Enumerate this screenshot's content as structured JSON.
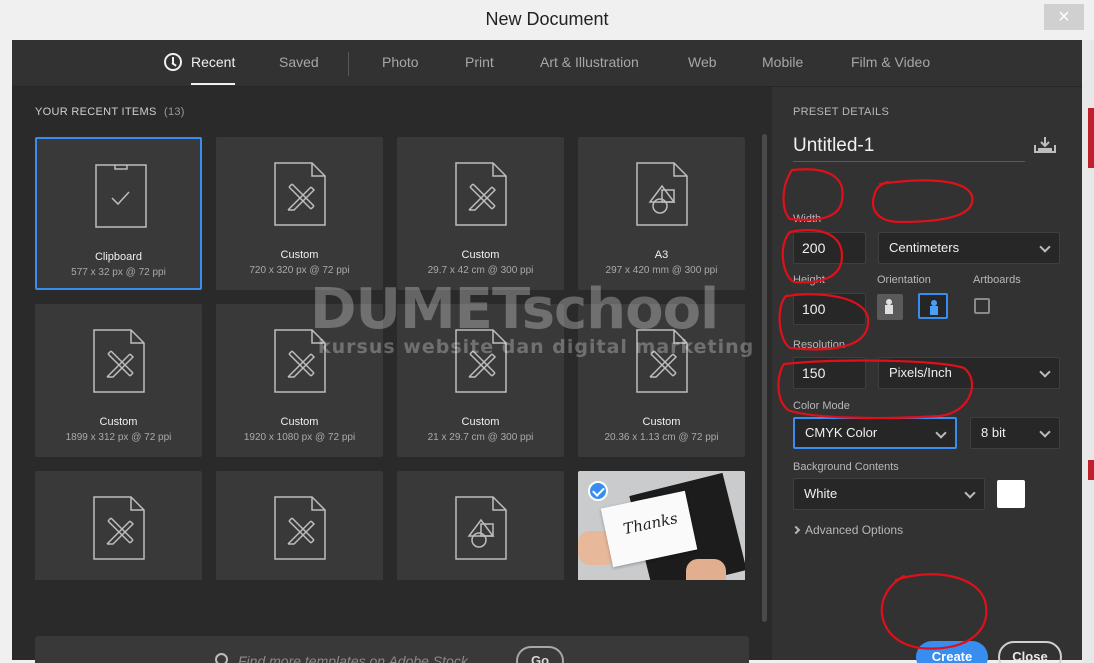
{
  "window": {
    "title": "New Document",
    "close_glyph": "×"
  },
  "tabs": [
    {
      "label": "Recent",
      "active": true
    },
    {
      "label": "Saved"
    },
    {
      "label": "Photo"
    },
    {
      "label": "Print"
    },
    {
      "label": "Art & Illustration"
    },
    {
      "label": "Web"
    },
    {
      "label": "Mobile"
    },
    {
      "label": "Film & Video"
    }
  ],
  "recent": {
    "heading": "YOUR RECENT ITEMS",
    "count": "(13)",
    "items": [
      {
        "name": "Clipboard",
        "desc": "577 x 32 px @ 72 ppi",
        "icon": "clipboard-doc-icon",
        "selected": true
      },
      {
        "name": "Custom",
        "desc": "720 x 320 px @ 72 ppi",
        "icon": "custom-doc-icon"
      },
      {
        "name": "Custom",
        "desc": "29.7 x 42 cm @ 300 ppi",
        "icon": "custom-doc-icon"
      },
      {
        "name": "A3",
        "desc": "297 x 420 mm @ 300 ppi",
        "icon": "shapes-doc-icon"
      },
      {
        "name": "Custom",
        "desc": "1899 x 312 px @ 72 ppi",
        "icon": "custom-doc-icon"
      },
      {
        "name": "Custom",
        "desc": "1920 x 1080 px @ 72 ppi",
        "icon": "custom-doc-icon"
      },
      {
        "name": "Custom",
        "desc": "21 x 29.7 cm @ 300 ppi",
        "icon": "custom-doc-icon"
      },
      {
        "name": "Custom",
        "desc": "20.36 x 1.13 cm @ 72 ppi",
        "icon": "custom-doc-icon"
      },
      {
        "icon": "custom-doc-icon"
      },
      {
        "icon": "custom-doc-icon"
      },
      {
        "icon": "shapes-doc-icon"
      },
      {
        "icon": "template-thumbnail",
        "photo_text": "Thanks"
      }
    ]
  },
  "search": {
    "placeholder": "Find more templates on Adobe Stock",
    "go_label": "Go"
  },
  "preset": {
    "heading": "PRESET DETAILS",
    "name": "Untitled-1",
    "width_label": "Width",
    "width_value": "200",
    "units": "Centimeters",
    "height_label": "Height",
    "height_value": "100",
    "orientation_label": "Orientation",
    "artboards_label": "Artboards",
    "resolution_label": "Resolution",
    "resolution_value": "150",
    "resolution_units": "Pixels/Inch",
    "color_mode_label": "Color Mode",
    "color_mode": "CMYK Color",
    "bit_depth": "8 bit",
    "background_label": "Background Contents",
    "background": "White",
    "advanced_label": "Advanced Options"
  },
  "buttons": {
    "create": "Create",
    "close": "Close"
  },
  "watermark": {
    "line1": "DUMETschool",
    "line2": "kursus website dan digital marketing"
  },
  "colors": {
    "accent": "#378ef0",
    "panel": "#323232",
    "annotation": "#e0101a"
  }
}
